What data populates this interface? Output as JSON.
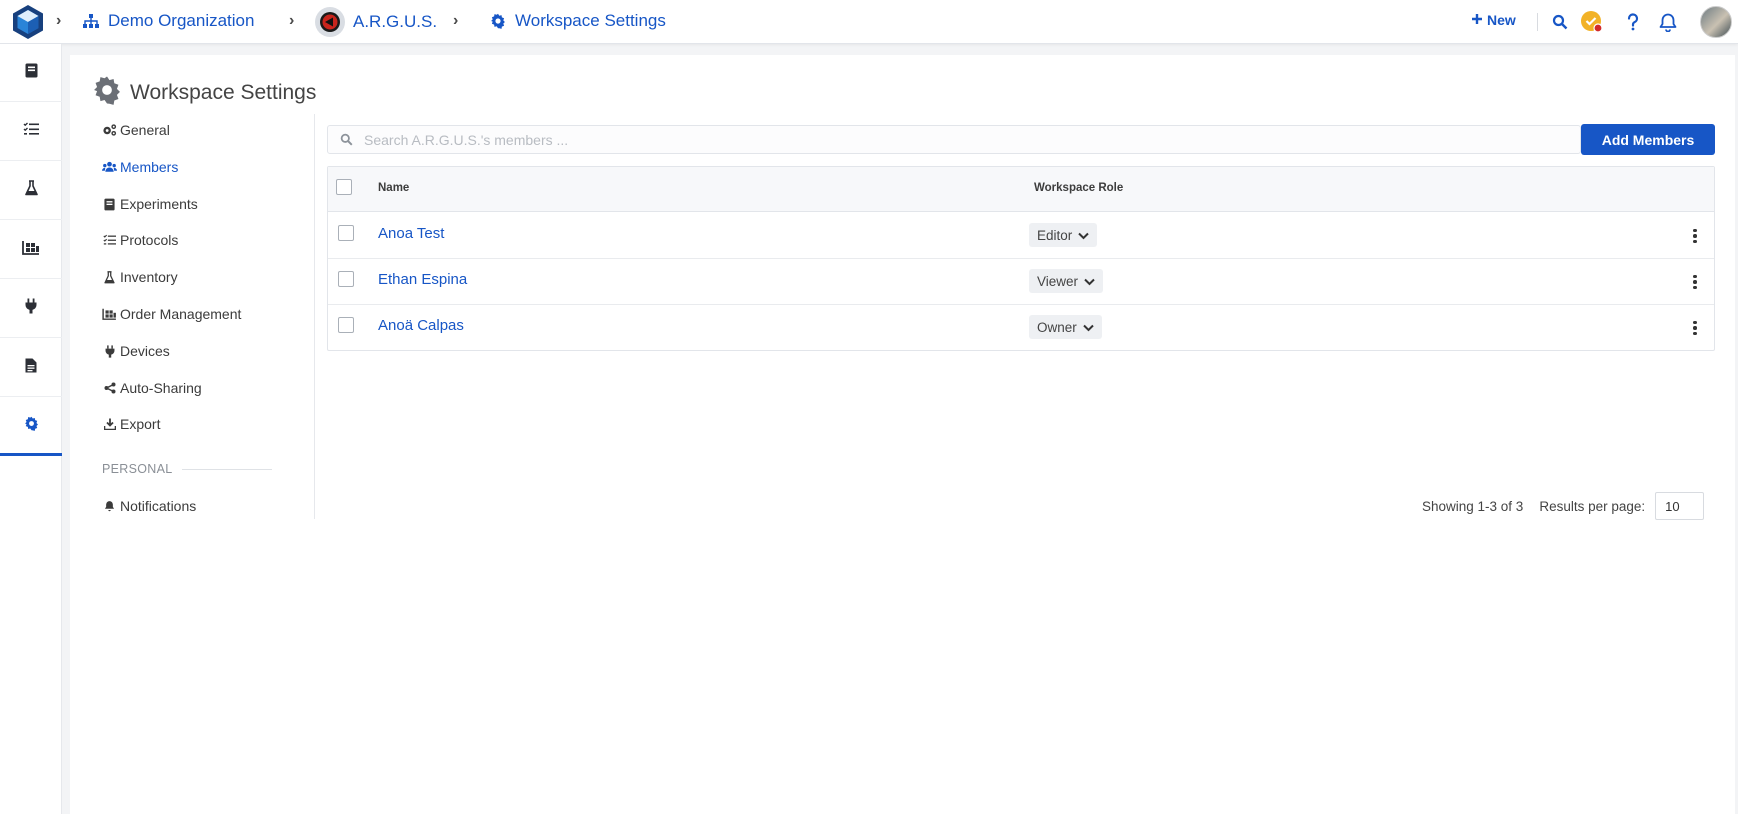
{
  "colors": {
    "accent": "#1756c6",
    "notification_dot": "#d22a2a",
    "status_badge": "#f2b227"
  },
  "header": {
    "breadcrumb": [
      {
        "label": "Demo Organization",
        "icon": "org-chart-icon"
      },
      {
        "label": "A.R.G.U.S.",
        "icon": "workspace-avatar"
      },
      {
        "label": "Workspace Settings",
        "icon": "gear-icon"
      }
    ],
    "new_label": "New",
    "icons": [
      "search-icon",
      "checklist-status-icon",
      "help-icon",
      "bell-icon",
      "user-avatar"
    ]
  },
  "rail": {
    "items": [
      {
        "icon": "notebook-icon",
        "active": false
      },
      {
        "icon": "protocol-list-icon",
        "active": false
      },
      {
        "icon": "flask-icon",
        "active": false
      },
      {
        "icon": "warehouse-icon",
        "active": false
      },
      {
        "icon": "plug-icon",
        "active": false
      },
      {
        "icon": "document-icon",
        "active": false
      },
      {
        "icon": "gear-icon",
        "active": true
      }
    ]
  },
  "page": {
    "title": "Workspace Settings"
  },
  "settings_nav": {
    "items": [
      {
        "label": "General",
        "icon": "gears-icon"
      },
      {
        "label": "Members",
        "icon": "users-icon",
        "active": true
      },
      {
        "label": "Experiments",
        "icon": "notebook-icon"
      },
      {
        "label": "Protocols",
        "icon": "protocol-list-icon"
      },
      {
        "label": "Inventory",
        "icon": "flask-icon"
      },
      {
        "label": "Order Management",
        "icon": "warehouse-icon"
      },
      {
        "label": "Devices",
        "icon": "plug-icon"
      },
      {
        "label": "Auto-Sharing",
        "icon": "share-icon"
      },
      {
        "label": "Export",
        "icon": "download-icon"
      }
    ],
    "personal_section": "PERSONAL",
    "personal_items": [
      {
        "label": "Notifications",
        "icon": "bell-icon"
      }
    ]
  },
  "members": {
    "search_placeholder": "Search A.R.G.U.S.'s members ...",
    "add_button": "Add Members",
    "columns": {
      "name": "Name",
      "role": "Workspace Role"
    },
    "rows": [
      {
        "name": "Anoa Test",
        "role": "Editor"
      },
      {
        "name": "Ethan Espina",
        "role": "Viewer"
      },
      {
        "name": "Anoä Calpas",
        "role": "Owner"
      }
    ],
    "pagination": {
      "showing": "Showing 1-3 of 3",
      "per_page_label": "Results per page:",
      "per_page_value": "10"
    }
  }
}
